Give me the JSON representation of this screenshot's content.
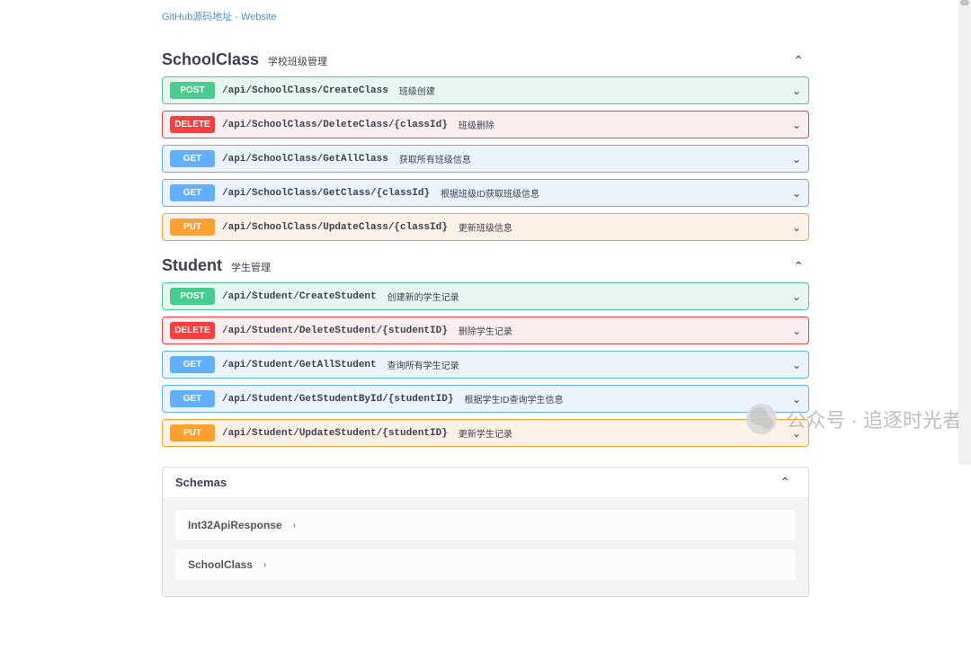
{
  "top_link": "GitHub源码地址 - Website",
  "sections": [
    {
      "title": "SchoolClass",
      "desc": "学校班级管理",
      "ops": [
        {
          "method": "POST",
          "css": "post",
          "path": "/api/SchoolClass/CreateClass",
          "desc": "班级创建"
        },
        {
          "method": "DELETE",
          "css": "delete",
          "path": "/api/SchoolClass/DeleteClass/{classId}",
          "desc": "班级删除"
        },
        {
          "method": "GET",
          "css": "get",
          "path": "/api/SchoolClass/GetAllClass",
          "desc": "获取所有班级信息"
        },
        {
          "method": "GET",
          "css": "get",
          "path": "/api/SchoolClass/GetClass/{classId}",
          "desc": "根据班级ID获取班级信息"
        },
        {
          "method": "PUT",
          "css": "put",
          "path": "/api/SchoolClass/UpdateClass/{classId}",
          "desc": "更新班级信息"
        }
      ]
    },
    {
      "title": "Student",
      "desc": "学生管理",
      "ops": [
        {
          "method": "POST",
          "css": "post",
          "path": "/api/Student/CreateStudent",
          "desc": "创建新的学生记录"
        },
        {
          "method": "DELETE",
          "css": "delete",
          "path": "/api/Student/DeleteStudent/{studentID}",
          "desc": "删除学生记录"
        },
        {
          "method": "GET",
          "css": "get",
          "path": "/api/Student/GetAllStudent",
          "desc": "查询所有学生记录"
        },
        {
          "method": "GET",
          "css": "get",
          "path": "/api/Student/GetStudentById/{studentID}",
          "desc": "根据学生ID查询学生信息"
        },
        {
          "method": "PUT",
          "css": "put",
          "path": "/api/Student/UpdateStudent/{studentID}",
          "desc": "更新学生记录"
        }
      ]
    }
  ],
  "schemas": {
    "title": "Schemas",
    "items": [
      "Int32ApiResponse",
      "SchoolClass"
    ]
  },
  "watermark": "公众号 · 追逐时光者",
  "glyphs": {
    "chevron_up": "⌃",
    "chevron_down": "⌄",
    "chevron_right": "›"
  }
}
